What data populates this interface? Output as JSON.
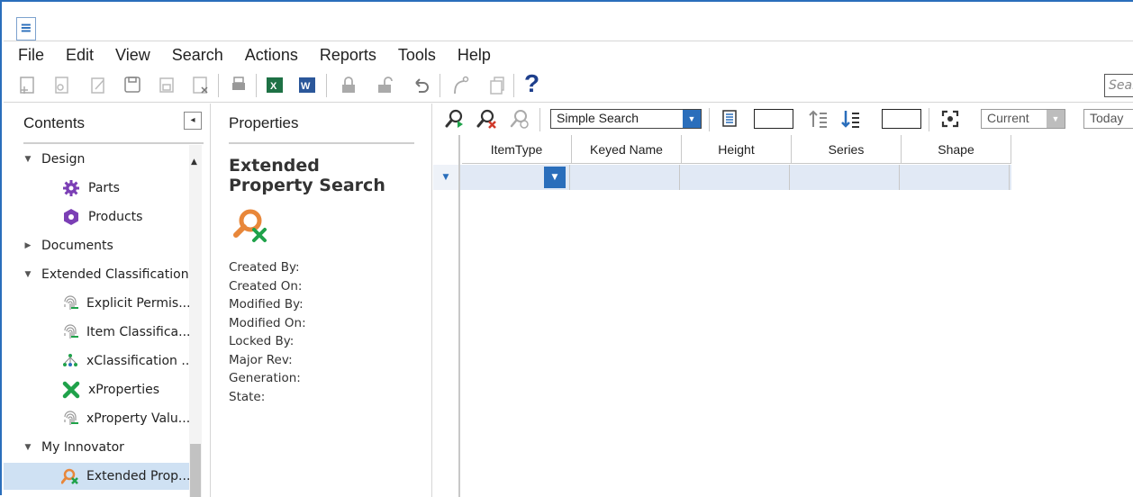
{
  "app": {
    "hamburger_label": "≡"
  },
  "menu": [
    "File",
    "Edit",
    "View",
    "Search",
    "Actions",
    "Reports",
    "Tools",
    "Help"
  ],
  "toolbar": {
    "help_label": "?",
    "search_placeholder": "Search"
  },
  "contents": {
    "title": "Contents",
    "collapse_label": "◂",
    "tree": [
      {
        "label": "Design",
        "level": 0,
        "expanded": true,
        "icon": "none"
      },
      {
        "label": "Parts",
        "level": 1,
        "icon": "gear-icon"
      },
      {
        "label": "Products",
        "level": 1,
        "icon": "product-icon"
      },
      {
        "label": "Documents",
        "level": 0,
        "expanded": false,
        "icon": "none"
      },
      {
        "label": "Extended Classification",
        "level": 0,
        "expanded": true,
        "icon": "none"
      },
      {
        "label": "Explicit Permis...",
        "level": 1,
        "icon": "fingerprint-icon"
      },
      {
        "label": "Item Classifica...",
        "level": 1,
        "icon": "fingerprint-icon"
      },
      {
        "label": "xClassification ...",
        "level": 1,
        "icon": "tree-nodes-icon"
      },
      {
        "label": "xProperties",
        "level": 1,
        "icon": "x-star-icon"
      },
      {
        "label": "xProperty Valu...",
        "level": 1,
        "icon": "fingerprint-icon"
      },
      {
        "label": "My Innovator",
        "level": 0,
        "expanded": true,
        "icon": "none"
      },
      {
        "label": "Extended Prop...",
        "level": 1,
        "icon": "search-x-icon",
        "selected": true
      }
    ]
  },
  "properties": {
    "title": "Properties",
    "heading": "Extended Property Search",
    "fields": [
      "Created By:",
      "Created On:",
      "Modified By:",
      "Modified On:",
      "Locked By:",
      "Major Rev:",
      "Generation:",
      "State:"
    ]
  },
  "grid_toolbar": {
    "search_mode": "Simple Search",
    "revision": "Current",
    "date": "Today"
  },
  "grid": {
    "columns": [
      "ItemType",
      "Keyed Name",
      "Height",
      "Series",
      "Shape"
    ],
    "row_values": [
      "",
      "",
      "",
      "",
      ""
    ]
  },
  "colors": {
    "accent": "#2a6ebb",
    "selected_bg": "#cfe1f3",
    "grid_row_bg": "#e1e9f5",
    "orange": "#e8873a",
    "green": "#1fa24a",
    "purple": "#7b3fb5"
  }
}
